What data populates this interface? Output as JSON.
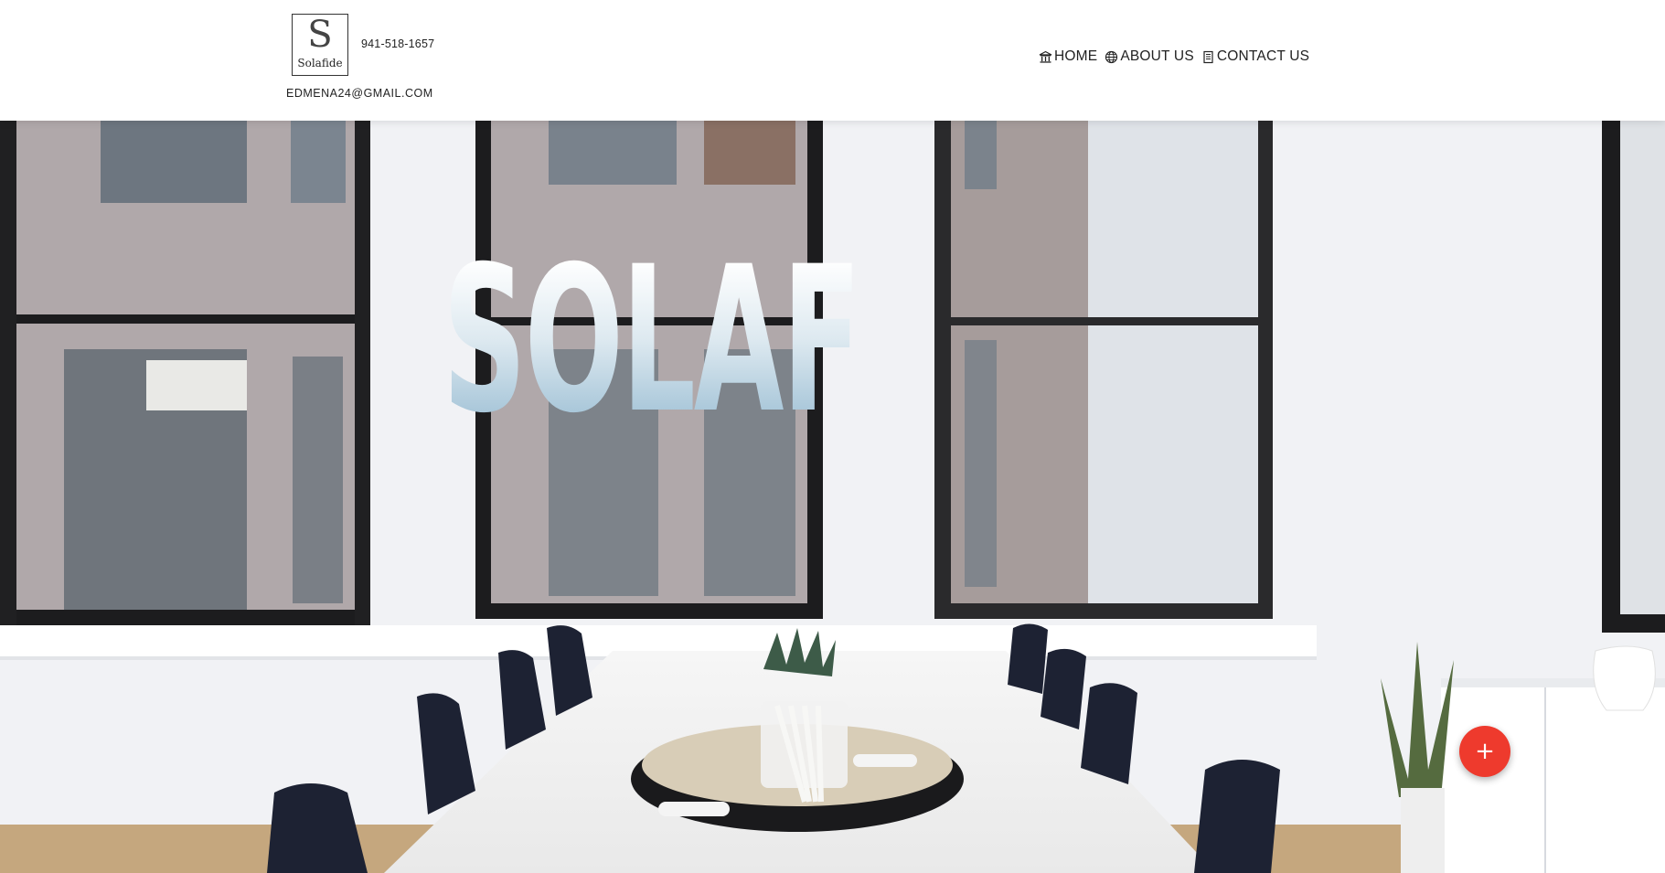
{
  "header": {
    "logo": {
      "letter": "S",
      "word": "Solafide"
    },
    "phone": "941-518-1657",
    "email": "EDMENA24@GMAIL.COM",
    "nav": [
      {
        "label": "HOME",
        "icon": "bank-icon"
      },
      {
        "label": "ABOUT US",
        "icon": "globe-icon"
      },
      {
        "label": "CONTACT US",
        "icon": "document-icon"
      }
    ]
  },
  "hero": {
    "title": "SOLAFIDE",
    "background_image": "office-conference-room-photo"
  },
  "fab": {
    "label": "+",
    "icon": "plus-icon",
    "color": "#ee3a2d"
  },
  "colors": {
    "title_gradient_top": "#ffffff",
    "title_gradient_bottom": "#95bad1",
    "header_background": "#ffffff"
  }
}
